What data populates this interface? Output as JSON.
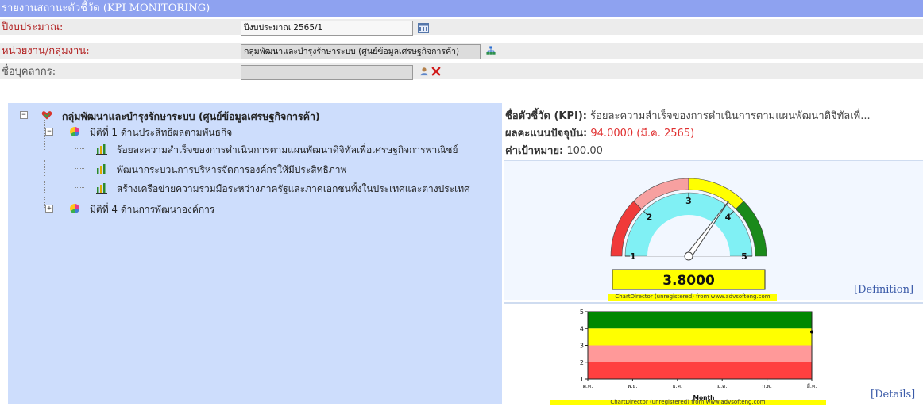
{
  "header": {
    "title": "รายงานสถานะตัวชี้วัด (KPI MONITORING)"
  },
  "form": {
    "year": {
      "label": "ปีงบประมาณ:",
      "value": "ปีงบประมาณ 2565/1"
    },
    "unit": {
      "label": "หน่วยงาน/กลุ่มงาน:",
      "value": "กลุ่มพัฒนาและบำรุงรักษาระบบ (ศูนย์ข้อมูลเศรษฐกิจการค้า)"
    },
    "person": {
      "label": "ชื่อบุคลากร:",
      "value": ""
    }
  },
  "tree": {
    "root": "กลุ่มพัฒนาและบำรุงรักษาระบบ (ศูนย์ข้อมูลเศรษฐกิจการค้า)",
    "dim1": "มิติที่ 1 ด้านประสิทธิผลตามพันธกิจ",
    "kpi1": "ร้อยละความสำเร็จของการดำเนินการตามแผนพัฒนาดิจิทัลเพื่อเศรษฐกิจการพาณิชย์",
    "kpi2": "พัฒนากระบวนการบริหารจัดการองค์กรให้มีประสิทธิภาพ",
    "kpi3": "สร้างเครือข่ายความร่วมมือระหว่างภาครัฐและภาคเอกชนทั้งในประเทศและต่างประเทศ",
    "dim4": "มิติที่ 4 ด้านการพัฒนาองค์การ"
  },
  "kpi_info": {
    "name_label": "ชื่อตัวชี้วัด (KPI):",
    "name_value": "ร้อยละความสำเร็จของการดำเนินการตามแผนพัฒนาดิจิทัลเพื่...",
    "score_label": "ผลคะแนนปัจจุบัน:",
    "score_value": "94.0000 (มี.ค. 2565)",
    "target_label": "ค่าเป้าหมาย:",
    "target_value": "100.00"
  },
  "gauge": {
    "value": 3.8,
    "display": "3.8000",
    "min": 1,
    "max": 5,
    "ticks": [
      "1",
      "2",
      "3",
      "4",
      "5"
    ]
  },
  "links": {
    "definition": "[Definition]",
    "details": "[Details]"
  },
  "watermark": "ChartDirector (unregistered) from www.advsofteng.com",
  "chart_data": {
    "type": "line",
    "x": [
      "ต.ค.",
      "พ.ย.",
      "ธ.ค.",
      "ม.ค.",
      "ก.พ.",
      "มี.ค."
    ],
    "series": [
      {
        "values": [
          null,
          null,
          null,
          null,
          null,
          3.8
        ]
      }
    ],
    "xlabel": "Month",
    "ylabel": "",
    "ylim": [
      1,
      5
    ],
    "yticks": [
      "1",
      "2",
      "3",
      "4",
      "5"
    ],
    "bands": [
      {
        "from": 1,
        "to": 2,
        "color": "#ff4040"
      },
      {
        "from": 2,
        "to": 3,
        "color": "#ff9999"
      },
      {
        "from": 3,
        "to": 4,
        "color": "#ffff00"
      },
      {
        "from": 4,
        "to": 5,
        "color": "#008800"
      }
    ]
  },
  "colors": {
    "titlebar": "#8ea2f0",
    "tree_bg": "#cdddfc",
    "score": "#e03030",
    "link": "#3a5aa8"
  }
}
